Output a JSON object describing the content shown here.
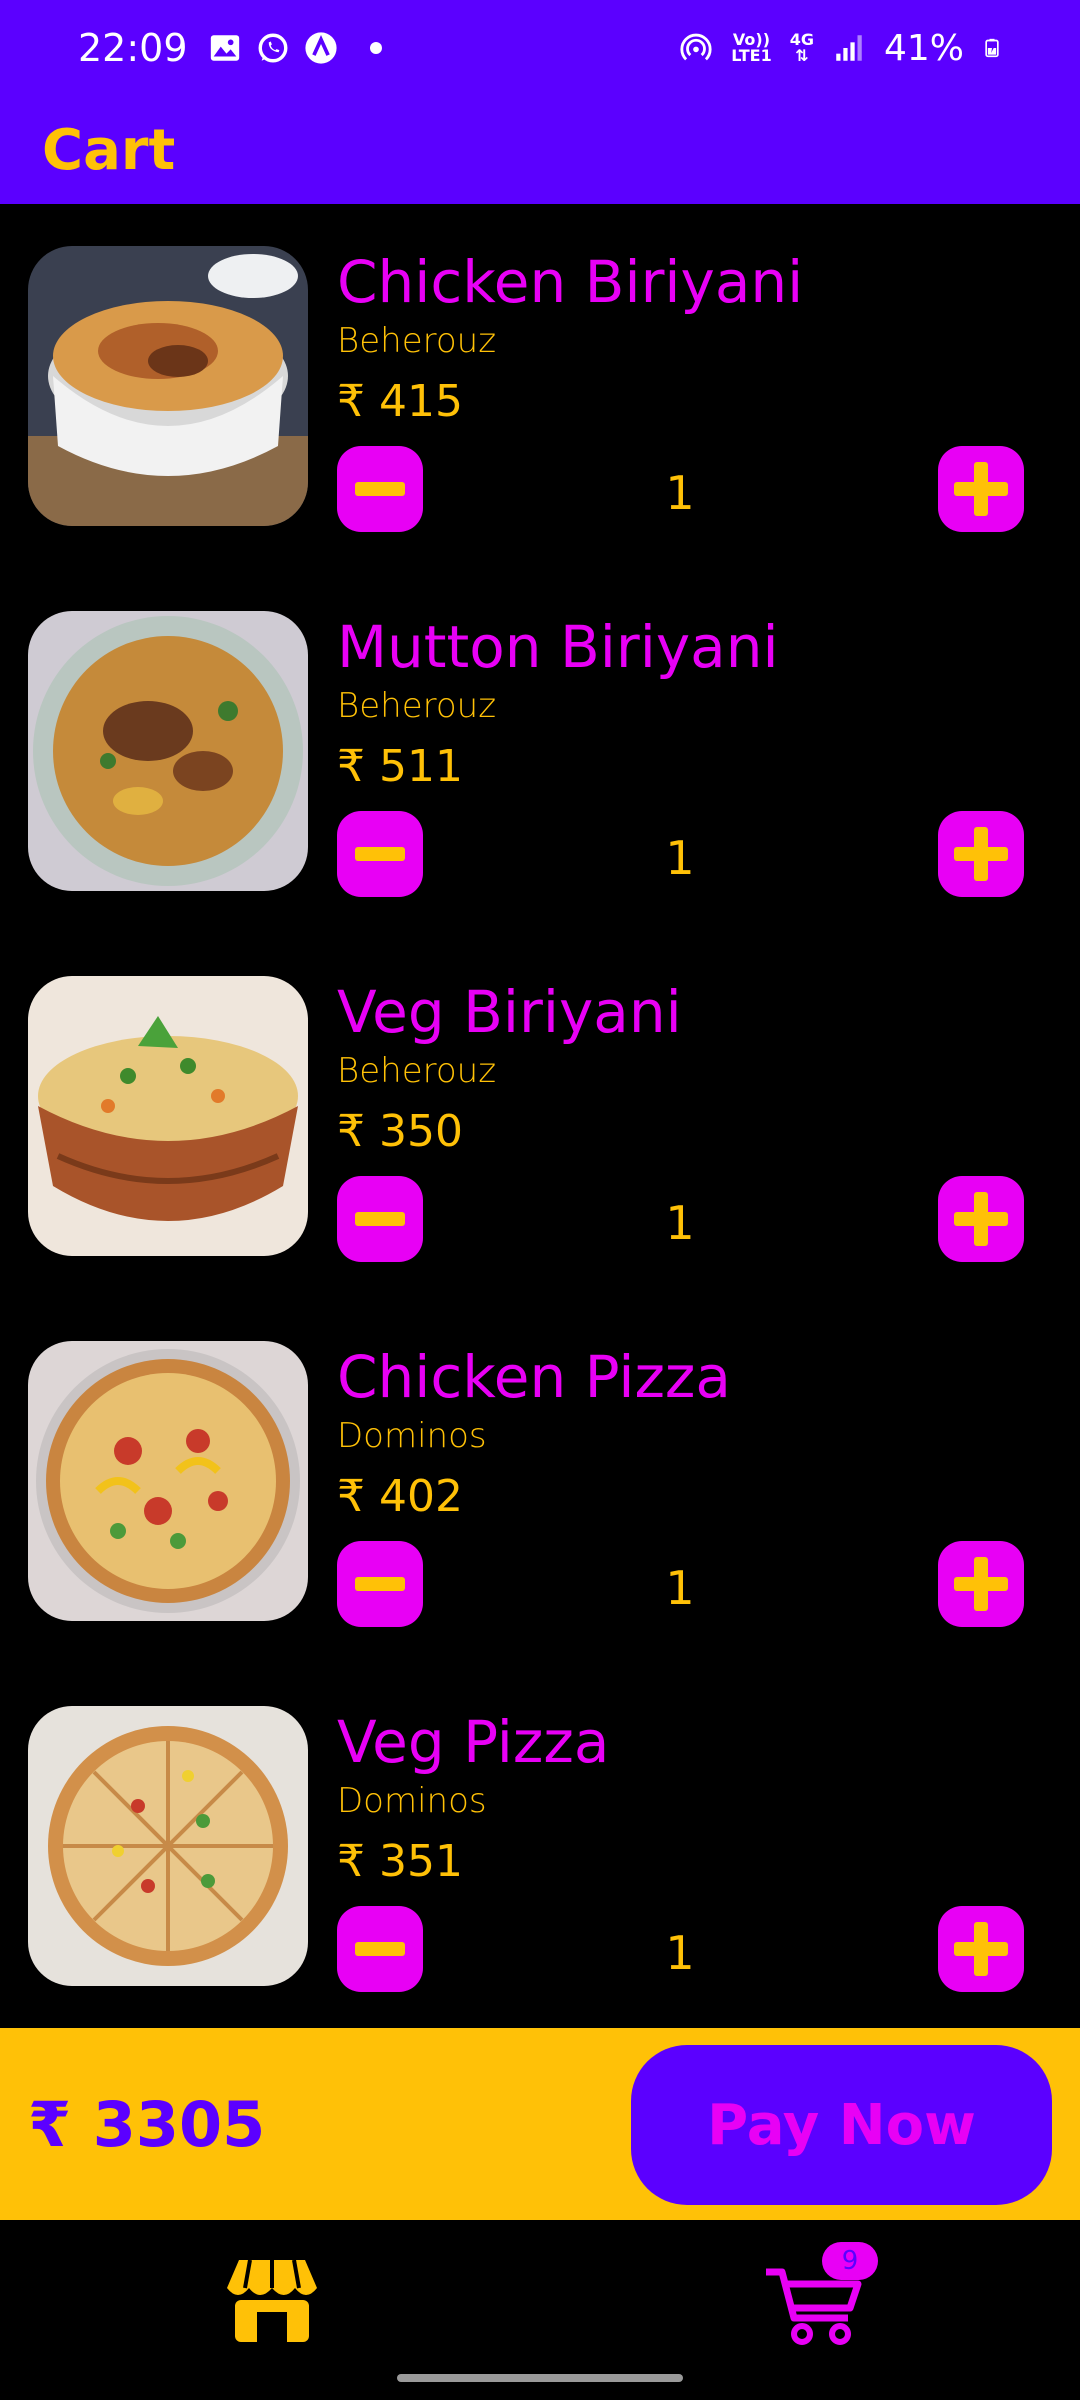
{
  "status_bar": {
    "time": "22:09",
    "battery": "41%",
    "network": "4G",
    "volte": "Vo))",
    "lte": "LTE1",
    "left_icons": [
      "gallery-icon",
      "whatsapp-icon",
      "app-icon",
      "notification-dot"
    ],
    "right_icons": [
      "hotspot-icon",
      "volte-icon",
      "4g-icon",
      "signal-icon",
      "battery-icon"
    ]
  },
  "app_bar": {
    "title": "Cart"
  },
  "cart": {
    "currency": "₹",
    "items": [
      {
        "name": "Chicken Biriyani",
        "store": "Beherouz",
        "price": "₹ 415",
        "quantity": "1",
        "image": "chicken-biriyani-image"
      },
      {
        "name": "Mutton Biriyani",
        "store": "Beherouz",
        "price": "₹ 511",
        "quantity": "1",
        "image": "mutton-biriyani-image"
      },
      {
        "name": "Veg Biriyani",
        "store": "Beherouz",
        "price": "₹ 350",
        "quantity": "1",
        "image": "veg-biriyani-image"
      },
      {
        "name": "Chicken Pizza",
        "store": "Dominos",
        "price": "₹ 402",
        "quantity": "1",
        "image": "chicken-pizza-image"
      },
      {
        "name": "Veg Pizza",
        "store": "Dominos",
        "price": "₹ 351",
        "quantity": "1",
        "image": "veg-pizza-image"
      }
    ]
  },
  "checkout": {
    "total": "₹ 3305",
    "pay_label": "Pay Now"
  },
  "bottom_nav": {
    "store_icon": "store-icon",
    "cart_icon": "cart-icon",
    "cart_badge": "9"
  },
  "colors": {
    "primary": "#5B00FF",
    "accent": "#FFC107",
    "magenta": "#E800F5",
    "background": "#000000"
  }
}
